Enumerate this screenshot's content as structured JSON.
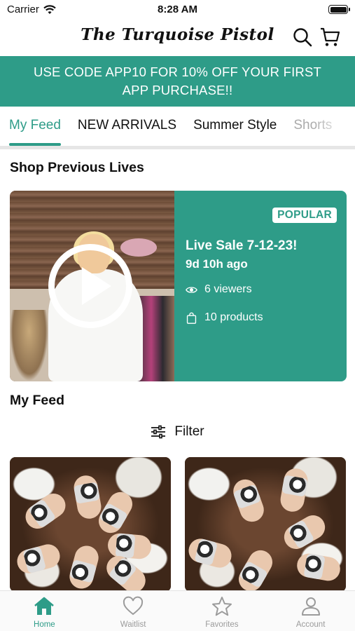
{
  "status_bar": {
    "carrier": "Carrier",
    "time": "8:28 AM"
  },
  "header": {
    "logo": "The Turquoise Pistol"
  },
  "promo": {
    "text": "USE CODE APP10 FOR 10% OFF YOUR FIRST APP PURCHASE!!"
  },
  "tabs": [
    {
      "label": "My Feed",
      "active": true
    },
    {
      "label": "NEW ARRIVALS"
    },
    {
      "label": "Summer Style"
    },
    {
      "label": "Shorts"
    }
  ],
  "sections": {
    "previous_lives": "Shop Previous Lives",
    "my_feed": "My Feed"
  },
  "live": {
    "badge": "POPULAR",
    "title": "Live Sale 7-12-23!",
    "ago": "9d 10h ago",
    "viewers": "6 viewers",
    "products": "10 products"
  },
  "filter": {
    "label": "Filter"
  },
  "bottom_nav": [
    {
      "label": "Home",
      "icon": "home-icon",
      "active": true
    },
    {
      "label": "Waitlist",
      "icon": "heart-icon"
    },
    {
      "label": "Favorites",
      "icon": "star-icon"
    },
    {
      "label": "Account",
      "icon": "person-icon"
    }
  ],
  "colors": {
    "accent": "#2e9c88",
    "inactive": "#9b9b9b"
  }
}
